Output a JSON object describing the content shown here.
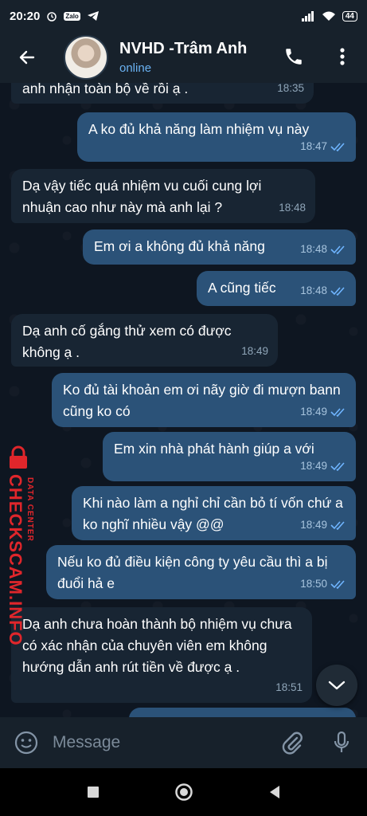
{
  "status_bar": {
    "time": "20:20",
    "zalo": "Zalo",
    "battery": "44"
  },
  "header": {
    "name": "NVHD -Trâm Anh",
    "status": "online"
  },
  "messages": [
    {
      "dir": "in",
      "text": "anh nhận toàn bộ về rồi ạ .",
      "time": "18:35"
    },
    {
      "dir": "out",
      "text": "A ko đủ khả năng làm nhiệm vụ này",
      "time": "18:47"
    },
    {
      "dir": "in",
      "text": "Dạ vậy tiếc quá nhiệm vu cuối cung lợi nhuận cao như này mà anh lại ?",
      "time": "18:48"
    },
    {
      "dir": "out",
      "text": "Em ơi a không đủ khả năng",
      "time": "18:48"
    },
    {
      "dir": "out",
      "text": "A cũng tiếc",
      "time": "18:48"
    },
    {
      "dir": "in",
      "text": "Dạ anh cố gắng thử xem có được không ạ .",
      "time": "18:49"
    },
    {
      "dir": "out",
      "text": "Ko đủ tài khoản em ơi nãy giờ đi mượn bann cũng ko có",
      "time": "18:49"
    },
    {
      "dir": "out",
      "text": "Em xin nhà phát hành giúp a với",
      "time": "18:49"
    },
    {
      "dir": "out",
      "text": "Khi nào làm a nghỉ chỉ cần bỏ tí vốn chứ a ko nghĩ nhiều vậy @@",
      "time": "18:49"
    },
    {
      "dir": "out",
      "text": "Nếu ko đủ điều kiện công ty yêu cầu thì a bị đuổi hả e",
      "time": "18:50"
    },
    {
      "dir": "in",
      "text": "Dạ anh chưa hoàn thành bộ nhiệm vụ chưa có xác nhận của chuyên viên em không hướng dẫn anh rút tiền về được ạ .",
      "time": "18:51"
    }
  ],
  "watermark": {
    "brand": "CHECKSCAM.INFO",
    "tagline": "DATA CENTER"
  },
  "input": {
    "placeholder": "Message"
  },
  "colors": {
    "background": "#0e1621",
    "bar": "#17212b",
    "incoming": "#182533",
    "outgoing": "#2b5278",
    "accent": "#6ab2f2",
    "watermark": "#e0262b"
  },
  "icons": [
    "back-arrow-icon",
    "phone-icon",
    "more-vert-icon",
    "chevron-down-icon",
    "emoji-icon",
    "paperclip-icon",
    "mic-icon",
    "nav-square-icon",
    "nav-home-icon",
    "nav-back-icon",
    "double-check-icon"
  ]
}
